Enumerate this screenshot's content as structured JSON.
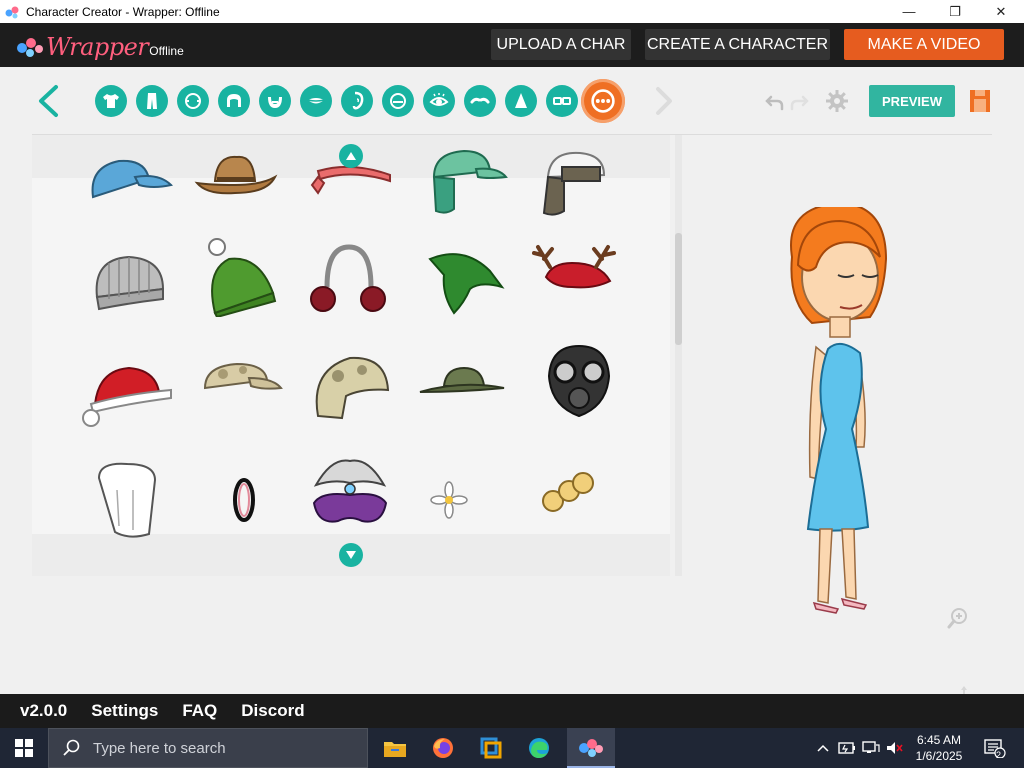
{
  "window": {
    "title": "Character Creator - Wrapper: Offline",
    "controls": {
      "minimize": "—",
      "restore": "❐",
      "close": "✕"
    }
  },
  "header": {
    "logo_text": "Wrapper",
    "logo_sub": "Offline",
    "buttons": {
      "upload": "UPLOAD A CHAR",
      "create": "CREATE A CHARACTER",
      "make_video": "MAKE A VIDEO"
    },
    "colors": {
      "accent_orange": "#e65c1f",
      "teal": "#19b3a1"
    }
  },
  "toolbar": {
    "categories": [
      {
        "icon": "shirt-icon"
      },
      {
        "icon": "pants-icon"
      },
      {
        "icon": "face-shape-icon"
      },
      {
        "icon": "hair-icon"
      },
      {
        "icon": "beard-icon"
      },
      {
        "icon": "mouth-icon"
      },
      {
        "icon": "ear-icon"
      },
      {
        "icon": "nose-line-icon"
      },
      {
        "icon": "eye-icon"
      },
      {
        "icon": "eyebrows-icon"
      },
      {
        "icon": "nose-icon"
      },
      {
        "icon": "glasses-icon"
      },
      {
        "icon": "accessory-icon",
        "active": true
      }
    ],
    "preview_label": "PREVIEW"
  },
  "parts": {
    "items": [
      {
        "name": "blue-cap"
      },
      {
        "name": "cowboy-hat"
      },
      {
        "name": "headband"
      },
      {
        "name": "trapper-cap-teal"
      },
      {
        "name": "aviator-hat"
      },
      {
        "name": "gray-beanie"
      },
      {
        "name": "green-pompom-beanie"
      },
      {
        "name": "earmuffs"
      },
      {
        "name": "green-elf-hat"
      },
      {
        "name": "reindeer-antler-hat"
      },
      {
        "name": "santa-hat"
      },
      {
        "name": "camo-cap"
      },
      {
        "name": "camo-helmet"
      },
      {
        "name": "ranger-hat"
      },
      {
        "name": "gas-mask"
      },
      {
        "name": "chef-hat"
      },
      {
        "name": "hair-clip"
      },
      {
        "name": "feather-mask"
      },
      {
        "name": "daisy"
      },
      {
        "name": "bun-clip"
      }
    ]
  },
  "footer": {
    "version": "v2.0.0",
    "settings": "Settings",
    "faq": "FAQ",
    "discord": "Discord"
  },
  "taskbar": {
    "search_placeholder": "Type here to search",
    "time": "6:45 AM",
    "date": "1/6/2025",
    "notification_count": "2"
  }
}
